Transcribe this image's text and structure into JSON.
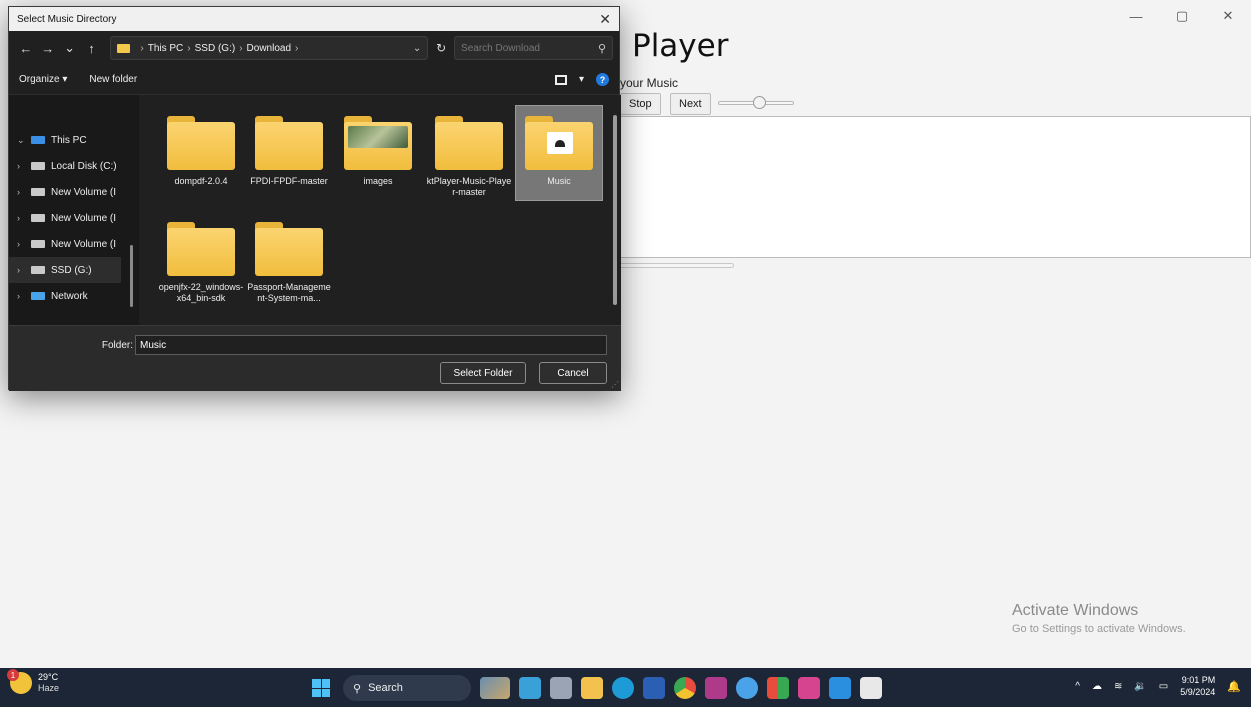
{
  "app": {
    "title": "Player",
    "subtitle": "your Music",
    "buttons": {
      "stop": "Stop",
      "next": "Next"
    },
    "volume_level": 0.55,
    "window_controls": {
      "minimize": "—",
      "restore": "▢",
      "close": "✕"
    },
    "watermark": {
      "line1": "Activate Windows",
      "line2": "Go to Settings to activate Windows."
    }
  },
  "dialog": {
    "title": "Select Music Directory",
    "close": "✕",
    "nav": {
      "back": "←",
      "forward": "→",
      "recent": "⌄",
      "up": "↑"
    },
    "breadcrumb": [
      "This PC",
      "SSD (G:)",
      "Download"
    ],
    "breadcrumb_sep": "›",
    "address_caret": "⌄",
    "refresh": "↻",
    "search_placeholder": "Search Download",
    "toolbar": {
      "organize": "Organize ▾",
      "new_folder": "New folder",
      "view_caret": "▾",
      "help": "?"
    },
    "nav_pane": [
      {
        "chev": "⌄",
        "label": "This PC"
      },
      {
        "chev": "›",
        "label": "Local Disk (C:)"
      },
      {
        "chev": "›",
        "label": "New Volume (I"
      },
      {
        "chev": "›",
        "label": "New Volume (I"
      },
      {
        "chev": "›",
        "label": "New Volume (I"
      },
      {
        "chev": "›",
        "label": "SSD (G:)"
      },
      {
        "chev": "›",
        "label": "Network"
      }
    ],
    "folders": [
      {
        "name": "dompdf-2.0.4"
      },
      {
        "name": "FPDI-FPDF-master"
      },
      {
        "name": "images"
      },
      {
        "name": "ktPlayer-Music-Player-master"
      },
      {
        "name": "Music"
      },
      {
        "name": "openjfx-22_windows-x64_bin-sdk"
      },
      {
        "name": "Passport-Management-System-ma..."
      }
    ],
    "folder_label": "Folder:",
    "folder_value": "Music",
    "select_button": "Select Folder",
    "cancel_button": "Cancel"
  },
  "taskbar": {
    "weather": {
      "temp": "29°C",
      "condition": "Haze",
      "badge": "1"
    },
    "search_label": "Search",
    "tray": {
      "chevron": "^",
      "time": "9:01 PM",
      "date": "5/9/2024"
    },
    "colors": {
      "background": "#1c2636",
      "accent": "#4ec2f7"
    }
  }
}
